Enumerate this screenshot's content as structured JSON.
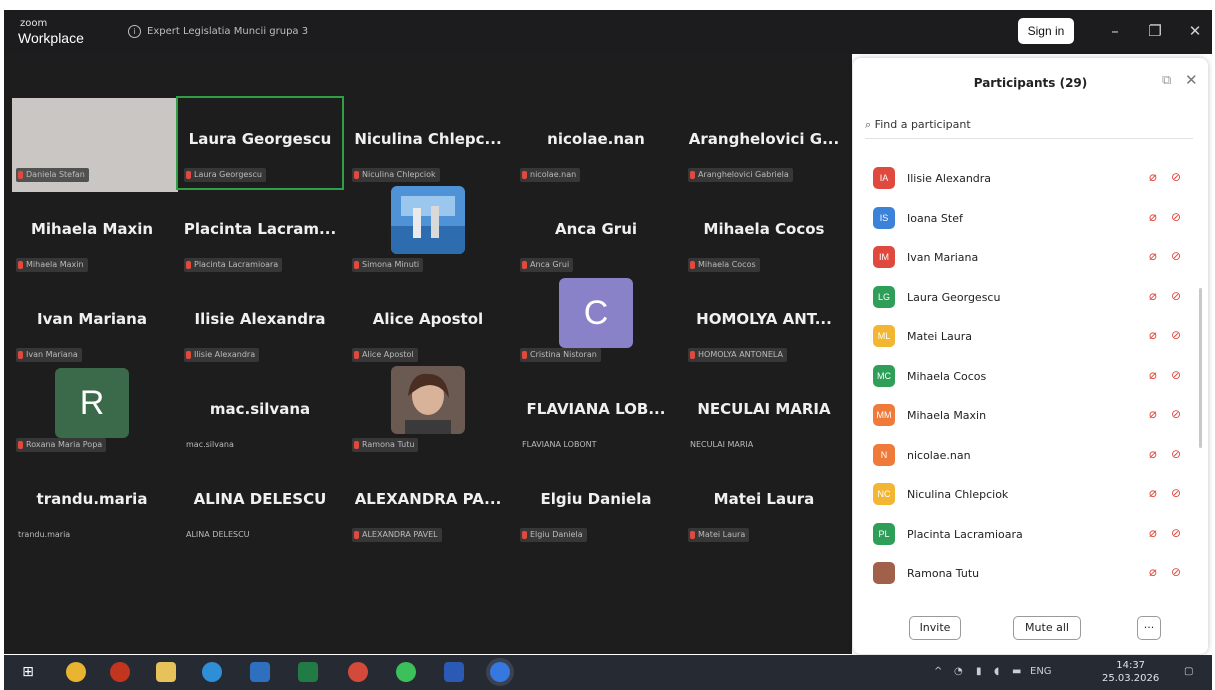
{
  "titlebar": {
    "logo_top": "zoom",
    "logo_bottom": "Workplace",
    "meeting_name": "Expert Legislatia Muncii grupa 3",
    "sign_in": "Sign in"
  },
  "tiles": [
    {
      "name": "",
      "tag": "Daniela Stefan",
      "type": "video"
    },
    {
      "name": "Laura Georgescu",
      "tag": "Laura Georgescu",
      "type": "name",
      "speaking": true
    },
    {
      "name": "Niculina  Chlepc...",
      "tag": "Niculina Chlepciok",
      "type": "name"
    },
    {
      "name": "nicolae.nan",
      "tag": "nicolae.nan",
      "type": "name"
    },
    {
      "name": "Aranghelovici  G...",
      "tag": "Aranghelovici Gabriela",
      "type": "name"
    },
    {
      "name": "Mihaela Maxin",
      "tag": "Mihaela Maxin",
      "type": "name"
    },
    {
      "name": "Placinta  Lacram...",
      "tag": "Placinta Lacramioara",
      "type": "name"
    },
    {
      "name": "",
      "tag": "Simona Minuti",
      "type": "photo-sea"
    },
    {
      "name": "Anca Grui",
      "tag": "Anca Grui",
      "type": "name"
    },
    {
      "name": "Mihaela Cocos",
      "tag": "Mihaela Cocos",
      "type": "name"
    },
    {
      "name": "Ivan Mariana",
      "tag": "Ivan Mariana",
      "type": "name"
    },
    {
      "name": "Ilisie Alexandra",
      "tag": "Ilisie Alexandra",
      "type": "name"
    },
    {
      "name": "Alice Apostol",
      "tag": "Alice Apostol",
      "type": "name"
    },
    {
      "name": "",
      "tag": "Cristina Nistoran",
      "type": "avatar",
      "letter": "C",
      "color": "#8a82c8"
    },
    {
      "name": "HOMOLYA  ANT...",
      "tag": "HOMOLYA ANTONELA",
      "type": "name"
    },
    {
      "name": "",
      "tag": "Roxana Maria Popa",
      "type": "avatar",
      "letter": "R",
      "color": "#3a6a4a"
    },
    {
      "name": "mac.silvana",
      "tag": "mac.silvana",
      "type": "name",
      "muted_plain": true
    },
    {
      "name": "",
      "tag": "Ramona Tutu",
      "type": "photo-face"
    },
    {
      "name": "FLAVIANA  LOB...",
      "tag": "FLAVIANA LOBONT",
      "type": "name",
      "muted_plain": true
    },
    {
      "name": "NECULAI MARIA",
      "tag": "NECULAI MARIA",
      "type": "name",
      "muted_plain": true
    },
    {
      "name": "trandu.maria",
      "tag": "trandu.maria",
      "type": "name",
      "muted_plain": true
    },
    {
      "name": "ALINA DELESCU",
      "tag": "ALINA DELESCU",
      "type": "name",
      "muted_plain": true
    },
    {
      "name": "ALEXANDRA  PA...",
      "tag": "ALEXANDRA PAVEL",
      "type": "name"
    },
    {
      "name": "Elgiu Daniela",
      "tag": "Elgiu Daniela",
      "type": "name"
    },
    {
      "name": "Matei Laura",
      "tag": "Matei Laura",
      "type": "name"
    }
  ],
  "panel": {
    "title": "Participants (29)",
    "search_placeholder": "Find a participant",
    "participants": [
      {
        "initials": "IA",
        "name": "Ilisie Alexandra",
        "color": "#e0493e"
      },
      {
        "initials": "IS",
        "name": "Ioana Stef",
        "color": "#3b82d8"
      },
      {
        "initials": "IM",
        "name": "Ivan Mariana",
        "color": "#e0493e"
      },
      {
        "initials": "LG",
        "name": "Laura Georgescu",
        "color": "#2e9e58"
      },
      {
        "initials": "ML",
        "name": "Matei Laura",
        "color": "#f2b632"
      },
      {
        "initials": "MC",
        "name": "Mihaela Cocos",
        "color": "#2e9e58"
      },
      {
        "initials": "MM",
        "name": "Mihaela Maxin",
        "color": "#f07a3a"
      },
      {
        "initials": "N",
        "name": "nicolae.nan",
        "color": "#f07a3a"
      },
      {
        "initials": "NC",
        "name": "Niculina Chlepciok",
        "color": "#f2b632"
      },
      {
        "initials": "PL",
        "name": "Placinta Lacramioara",
        "color": "#2e9e58"
      },
      {
        "initials": "",
        "name": "Ramona Tutu",
        "color": "#a0604a"
      }
    ],
    "invite": "Invite",
    "mute_all": "Mute all",
    "more": "···"
  },
  "taskbar": {
    "lang": "ENG",
    "time": "14:37",
    "date": "25.03.2026"
  }
}
